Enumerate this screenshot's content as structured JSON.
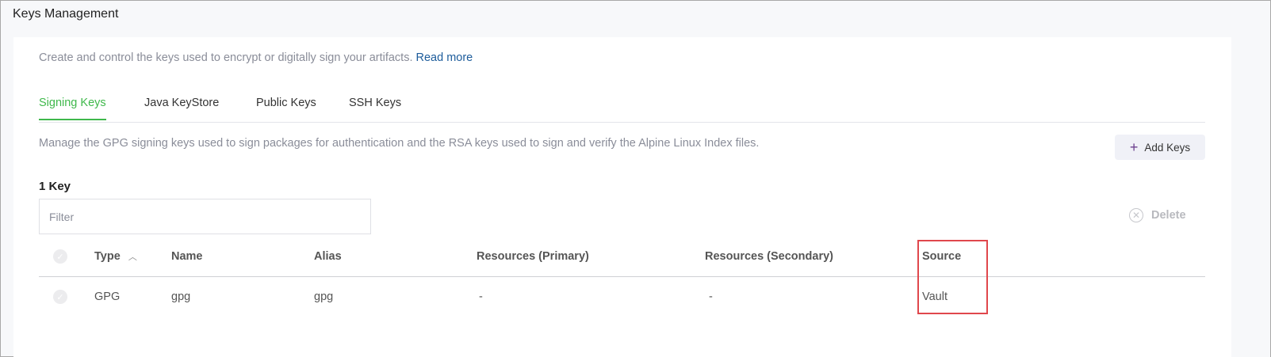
{
  "title": "Keys Management",
  "description": "Create and control the keys used to encrypt or digitally sign your artifacts.",
  "read_more": "Read more",
  "tabs": [
    {
      "label": "Signing Keys"
    },
    {
      "label": "Java KeyStore"
    },
    {
      "label": "Public Keys"
    },
    {
      "label": "SSH Keys"
    }
  ],
  "subtitle": "Manage the GPG signing keys used to sign packages for authentication and the RSA keys used to sign and verify the Alpine Linux Index files.",
  "add_keys": "Add Keys",
  "count": "1 Key",
  "filter_placeholder": "Filter",
  "delete": "Delete",
  "columns": [
    "Type",
    "Name",
    "Alias",
    "Resources (Primary)",
    "Resources (Secondary)",
    "Source"
  ],
  "rows": [
    [
      "GPG",
      "gpg",
      "gpg",
      "-",
      "-",
      "Vault"
    ]
  ]
}
